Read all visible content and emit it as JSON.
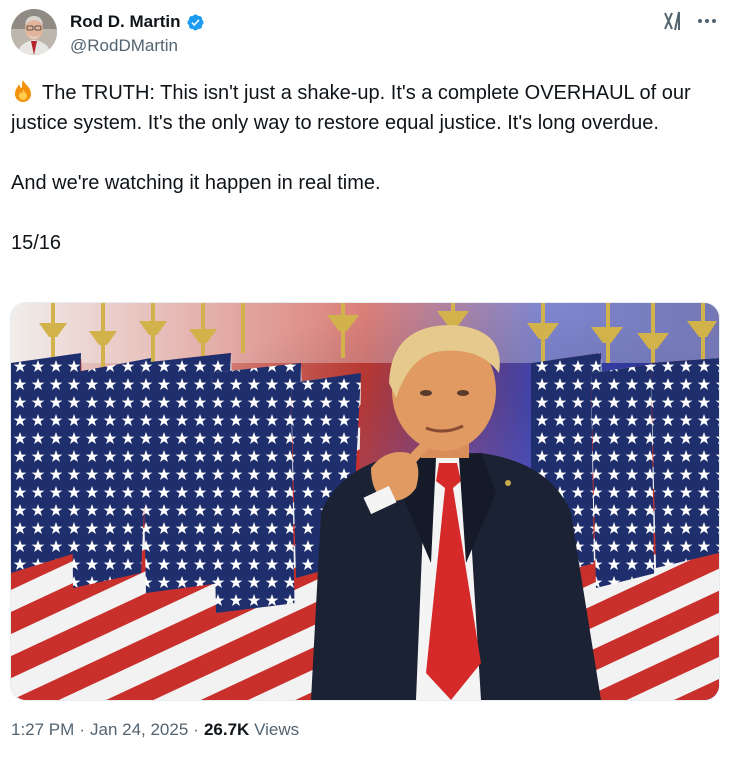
{
  "author": {
    "display_name": "Rod D. Martin",
    "handle": "@RodDMartin",
    "verified": true
  },
  "tweet": {
    "emoji": "fire-icon",
    "paragraph_1": "The TRUTH: This isn't just a shake-up. It's a complete OVERHAUL of our justice system. It's the only way to restore equal justice. It's long overdue.",
    "paragraph_2": "And we're watching it happen in real time.",
    "paragraph_3": "15/16"
  },
  "meta": {
    "time": "1:27 PM",
    "date": "Jan 24, 2025",
    "views_count": "26.7K",
    "views_label": "Views"
  },
  "colors": {
    "text_primary": "#0f1419",
    "text_secondary": "#536471",
    "verified_blue": "#1d9bf0",
    "tie_red": "#d62a2a",
    "flag_blue": "#1f2f6e"
  }
}
